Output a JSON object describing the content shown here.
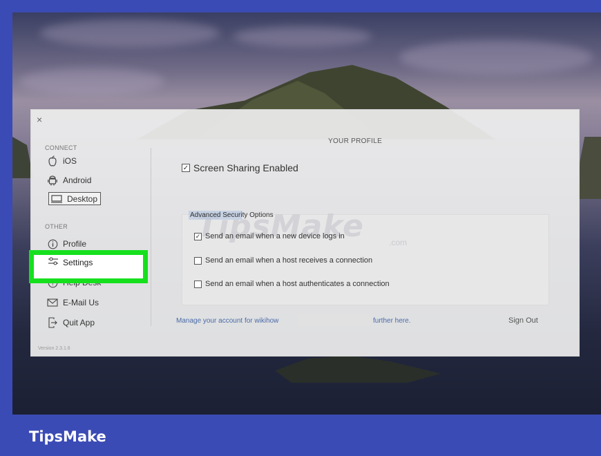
{
  "dialog": {
    "close_label": "×",
    "version": "Version 2.3.1.6"
  },
  "sidebar": {
    "connect_label": "CONNECT",
    "other_label": "OTHER",
    "connect_items": [
      {
        "label": "iOS",
        "icon": "apple-icon"
      },
      {
        "label": "Android",
        "icon": "android-icon"
      },
      {
        "label": "Desktop",
        "icon": "desktop-icon"
      }
    ],
    "other_items": [
      {
        "label": "Profile",
        "icon": "info-icon"
      },
      {
        "label": "Settings",
        "icon": "settings-icon"
      },
      {
        "label": "Help Desk",
        "icon": "help-icon"
      },
      {
        "label": "E-Mail Us",
        "icon": "mail-icon"
      },
      {
        "label": "Quit App",
        "icon": "quit-icon"
      }
    ]
  },
  "main": {
    "title": "YOUR PROFILE",
    "screen_sharing": {
      "label": "Screen Sharing Enabled",
      "checked": true
    },
    "advanced": {
      "title": "Advanced Security Options",
      "options": [
        {
          "label": "Send an email when a new device logs in",
          "checked": true
        },
        {
          "label": "Send an email when a host receives a connection",
          "checked": false
        },
        {
          "label": "Send an email when a host authenticates a connection",
          "checked": false
        }
      ]
    },
    "footer": {
      "manage_text": "Manage your account for wikihow",
      "manage_suffix": "further here.",
      "sign_out": "Sign Out"
    }
  },
  "watermark": {
    "main": "TipsMake",
    "sub": ".com"
  },
  "brand": {
    "name": "TipsMake"
  },
  "colors": {
    "brand_bar": "#3b4bb5",
    "highlight": "#16e01e",
    "link": "#4a6aa8"
  }
}
